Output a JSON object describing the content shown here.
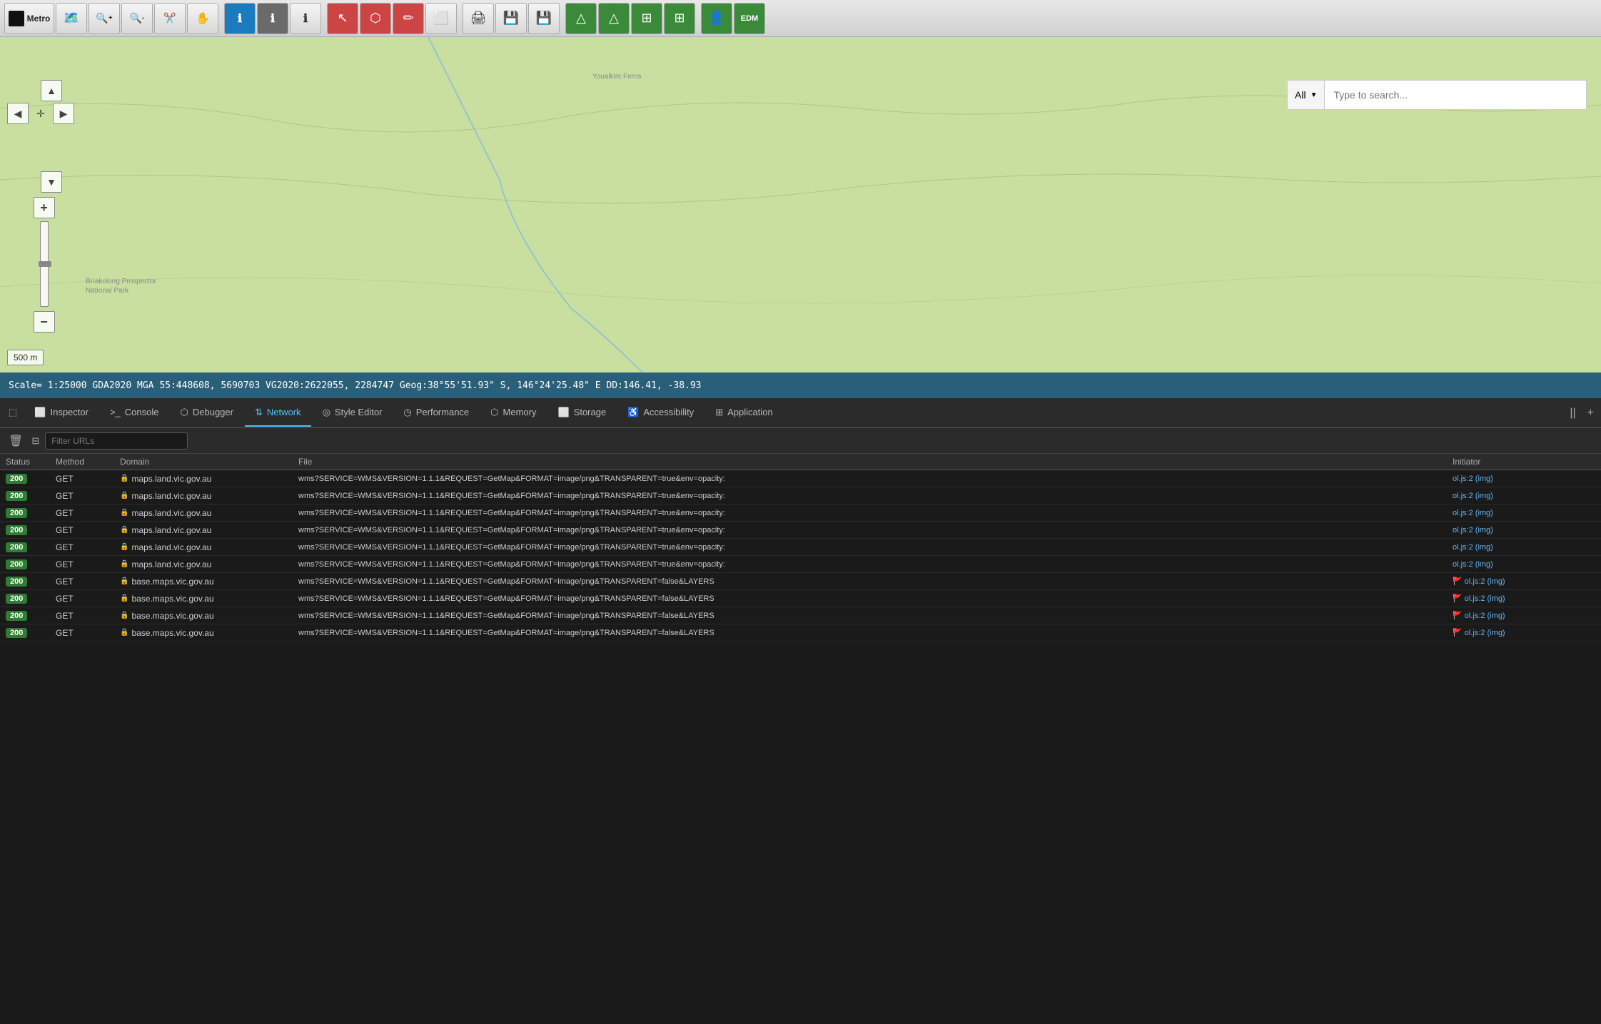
{
  "toolbar": {
    "app_label": "Metro",
    "buttons": [
      {
        "id": "logo",
        "icon": "⬛",
        "label": "Metro"
      },
      {
        "id": "cursor",
        "icon": "🗺️"
      },
      {
        "id": "zoom-in",
        "icon": "🔍+"
      },
      {
        "id": "zoom-out",
        "icon": "🔍-"
      },
      {
        "id": "select",
        "icon": "✂️"
      },
      {
        "id": "pan",
        "icon": "✋"
      },
      {
        "id": "info-blue",
        "icon": "ℹ"
      },
      {
        "id": "info-gray",
        "icon": "ℹ"
      },
      {
        "id": "info-white",
        "icon": "ℹ"
      },
      {
        "id": "arrow-red",
        "icon": "↖"
      },
      {
        "id": "polygon",
        "icon": "⬡"
      },
      {
        "id": "pencil-red",
        "icon": "✏"
      },
      {
        "id": "eraser",
        "icon": "⬜"
      },
      {
        "id": "print",
        "icon": "🖨"
      },
      {
        "id": "save1",
        "icon": "💾"
      },
      {
        "id": "save2",
        "icon": "💾"
      },
      {
        "id": "triangle1",
        "icon": "△"
      },
      {
        "id": "triangle2",
        "icon": "△"
      },
      {
        "id": "grid1",
        "icon": "⊞"
      },
      {
        "id": "grid2",
        "icon": "⊞"
      },
      {
        "id": "person",
        "icon": "👤"
      },
      {
        "id": "edm",
        "icon": "EDM"
      }
    ]
  },
  "map": {
    "scale_label": "500 m"
  },
  "search": {
    "dropdown_value": "All",
    "placeholder": "Type to search..."
  },
  "status_bar": {
    "text": "Scale= 1:25000  GDA2020  MGA 55:448608, 5690703  VG2020:2622055, 2284747  Geog:38°55'51.93\" S, 146°24'25.48\" E  DD:146.41, -38.93"
  },
  "devtools": {
    "tabs": [
      {
        "id": "picker",
        "icon": "⬚",
        "label": "",
        "active": false
      },
      {
        "id": "inspector",
        "icon": "⬜",
        "label": "Inspector",
        "active": false
      },
      {
        "id": "console",
        "icon": "⊡",
        "label": "Console",
        "active": false
      },
      {
        "id": "debugger",
        "icon": "⬡",
        "label": "Debugger",
        "active": false
      },
      {
        "id": "network",
        "icon": "⇅",
        "label": "Network",
        "active": true
      },
      {
        "id": "style-editor",
        "icon": "◎",
        "label": "Style Editor",
        "active": false
      },
      {
        "id": "performance",
        "icon": "◷",
        "label": "Performance",
        "active": false
      },
      {
        "id": "memory",
        "icon": "⬡",
        "label": "Memory",
        "active": false
      },
      {
        "id": "storage",
        "icon": "⬜",
        "label": "Storage",
        "active": false
      },
      {
        "id": "accessibility",
        "icon": "♿",
        "label": "Accessibility",
        "active": false
      },
      {
        "id": "application",
        "icon": "⊞",
        "label": "Application",
        "active": false
      }
    ],
    "toolbar": {
      "clear_label": "🗑",
      "filter_placeholder": "Filter URLs"
    },
    "network": {
      "columns": [
        "Status",
        "Method",
        "Domain",
        "File",
        "Initiator"
      ],
      "rows": [
        {
          "status": "200",
          "method": "GET",
          "domain": "maps.land.vic.gov.au",
          "file": "wms?SERVICE=WMS&VERSION=1.1.1&REQUEST=GetMap&FORMAT=image/png&TRANSPARENT=true&env=opacity:",
          "initiator": "ol.js:2",
          "initiator_suffix": "(img)"
        },
        {
          "status": "200",
          "method": "GET",
          "domain": "maps.land.vic.gov.au",
          "file": "wms?SERVICE=WMS&VERSION=1.1.1&REQUEST=GetMap&FORMAT=image/png&TRANSPARENT=true&env=opacity:",
          "initiator": "ol.js:2",
          "initiator_suffix": "(img)"
        },
        {
          "status": "200",
          "method": "GET",
          "domain": "maps.land.vic.gov.au",
          "file": "wms?SERVICE=WMS&VERSION=1.1.1&REQUEST=GetMap&FORMAT=image/png&TRANSPARENT=true&env=opacity:",
          "initiator": "ol.js:2",
          "initiator_suffix": "(img)"
        },
        {
          "status": "200",
          "method": "GET",
          "domain": "maps.land.vic.gov.au",
          "file": "wms?SERVICE=WMS&VERSION=1.1.1&REQUEST=GetMap&FORMAT=image/png&TRANSPARENT=true&env=opacity:",
          "initiator": "ol.js:2",
          "initiator_suffix": "(img)"
        },
        {
          "status": "200",
          "method": "GET",
          "domain": "maps.land.vic.gov.au",
          "file": "wms?SERVICE=WMS&VERSION=1.1.1&REQUEST=GetMap&FORMAT=image/png&TRANSPARENT=true&env=opacity:",
          "initiator": "ol.js:2",
          "initiator_suffix": "(img)"
        },
        {
          "status": "200",
          "method": "GET",
          "domain": "maps.land.vic.gov.au",
          "file": "wms?SERVICE=WMS&VERSION=1.1.1&REQUEST=GetMap&FORMAT=image/png&TRANSPARENT=true&env=opacity:",
          "initiator": "ol.js:2",
          "initiator_suffix": "(img)"
        },
        {
          "status": "200",
          "method": "GET",
          "domain": "base.maps.vic.gov.au",
          "file": "wms?SERVICE=WMS&VERSION=1.1.1&REQUEST=GetMap&FORMAT=image/png&TRANSPARENT=false&LAYERS",
          "initiator": "ol.js:2",
          "initiator_suffix": "(img)",
          "has_flag": true
        },
        {
          "status": "200",
          "method": "GET",
          "domain": "base.maps.vic.gov.au",
          "file": "wms?SERVICE=WMS&VERSION=1.1.1&REQUEST=GetMap&FORMAT=image/png&TRANSPARENT=false&LAYERS",
          "initiator": "ol.js:2",
          "initiator_suffix": "(img)",
          "has_flag": true
        },
        {
          "status": "200",
          "method": "GET",
          "domain": "base.maps.vic.gov.au",
          "file": "wms?SERVICE=WMS&VERSION=1.1.1&REQUEST=GetMap&FORMAT=image/png&TRANSPARENT=false&LAYERS",
          "initiator": "ol.js:2",
          "initiator_suffix": "(img)",
          "has_flag": true
        },
        {
          "status": "200",
          "method": "GET",
          "domain": "base.maps.vic.gov.au",
          "file": "wms?SERVICE=WMS&VERSION=1.1.1&REQUEST=GetMap&FORMAT=image/png&TRANSPARENT=false&LAYERS",
          "initiator": "ol.js:2",
          "initiator_suffix": "(img)",
          "has_flag": true
        }
      ]
    }
  },
  "nav": {
    "up": "▲",
    "left": "◀",
    "right": "▶",
    "down": "▼",
    "zoom_in": "+",
    "zoom_out": "−"
  }
}
